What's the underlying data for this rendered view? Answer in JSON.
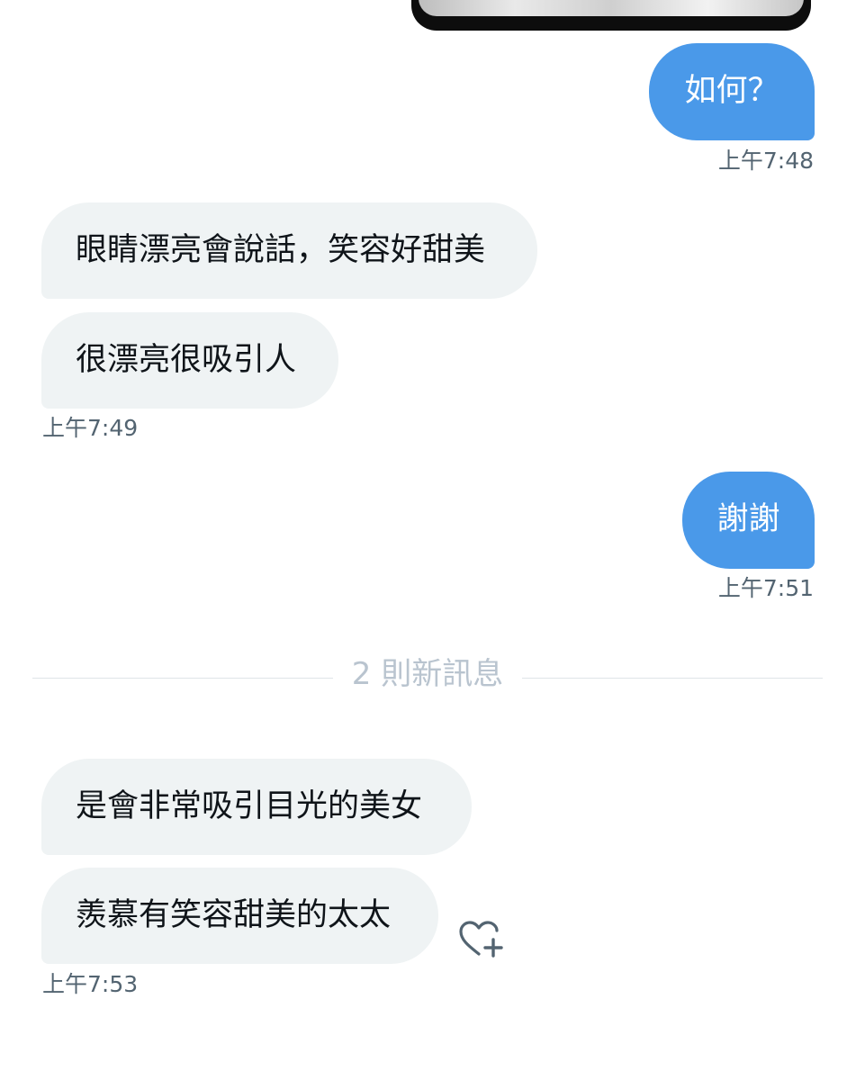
{
  "conversation": {
    "messages": [
      {
        "id": "m1",
        "direction": "outgoing",
        "text": "如何？"
      },
      {
        "id": "m2",
        "direction": "incoming",
        "text": "眼睛漂亮會說話，笑容好甜美"
      },
      {
        "id": "m3",
        "direction": "incoming",
        "text": "很漂亮很吸引人"
      },
      {
        "id": "m4",
        "direction": "outgoing",
        "text": "謝謝"
      },
      {
        "id": "m5",
        "direction": "incoming",
        "text": "是會非常吸引目光的美女"
      },
      {
        "id": "m6",
        "direction": "incoming",
        "text": "羨慕有笑容甜美的太太"
      }
    ],
    "timestamps": {
      "t1": "上午7:48",
      "t2": "上午7:49",
      "t3": "上午7:51",
      "t4": "上午7:53"
    },
    "new_messages_divider": "2 則新訊息"
  },
  "icons": {
    "react": "heart-plus-icon"
  },
  "colors": {
    "outgoing_bubble": "#4a99e9",
    "incoming_bubble": "#eff3f4",
    "timestamp_text": "#536471",
    "divider_text": "#b9c4cf"
  }
}
